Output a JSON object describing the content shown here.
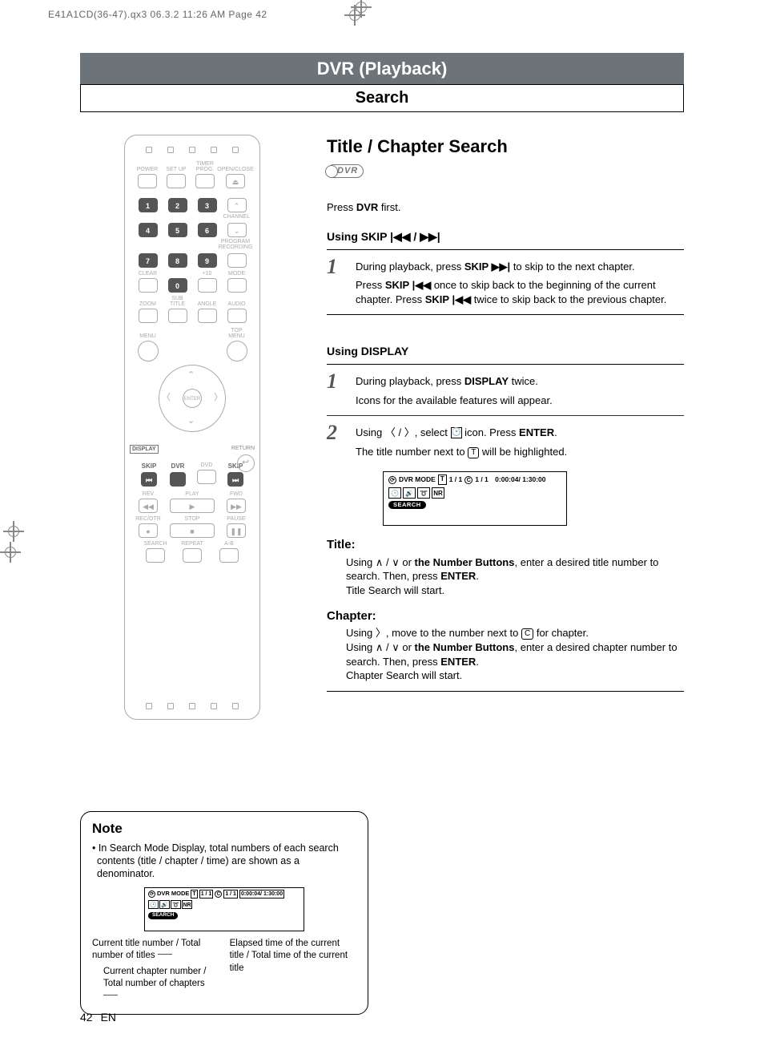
{
  "printmeta": "E41A1CD(36-47).qx3  06.3.2 11:26 AM  Page 42",
  "banner": "DVR (Playback)",
  "subbanner": "Search",
  "section_title": "Title / Chapter Search",
  "dvr_badge": "DVR",
  "intro": {
    "pre": "Press ",
    "bold": "DVR",
    "post": " first."
  },
  "using_skip_label": "Using SKIP |◀◀ / ▶▶|",
  "skip_step1": {
    "num": "1",
    "p1": {
      "pre": "During playback, press ",
      "bold": "SKIP ▶▶|",
      "post": " to skip to the next chapter."
    },
    "p2": {
      "a": "Press ",
      "b": "SKIP |◀◀",
      "c": " once to skip back to the beginning of the current chapter.  Press ",
      "d": "SKIP |◀◀",
      "e": " twice to skip back to the previous chapter."
    }
  },
  "using_display_label": "Using DISPLAY",
  "disp_step1": {
    "num": "1",
    "p1": {
      "pre": "During playback, press ",
      "bold": "DISPLAY",
      "post": " twice."
    },
    "p2": "Icons for the available features will appear."
  },
  "disp_step2": {
    "num": "2",
    "p1": {
      "a": "Using ",
      "b": "〈 / 〉",
      "c": ", select ",
      "d": " icon.  Press ",
      "e": "ENTER",
      "f": "."
    },
    "p2": {
      "a": "The title number next to ",
      "t": "T",
      "b": " will be highlighted."
    }
  },
  "osd": {
    "mode": "DVR MODE",
    "t": "T",
    "tval": "1 / 1",
    "c": "C",
    "cval": "1 / 1",
    "time": "0:00:04/ 1:30:00",
    "icons": [
      "🕑",
      "🔊",
      "➰",
      "NR"
    ],
    "search": "SEARCH"
  },
  "title_block": {
    "h": "Title:",
    "l1": {
      "a": "Using ",
      "b": "∧ / ∨",
      "c": " or ",
      "d": "the Number Buttons",
      "e": ", enter a desired title number to search.  Then, press ",
      "f": "ENTER",
      "g": "."
    },
    "l2": "Title Search will start."
  },
  "chapter_block": {
    "h": "Chapter:",
    "l1": {
      "a": "Using ",
      "b": "〉",
      "c": ", move to the number next to ",
      "d": "C",
      "e": " for chapter."
    },
    "l2": {
      "a": "Using ",
      "b": "∧ / ∨",
      "c": " or ",
      "d": "the Number Buttons",
      "e": ", enter a desired chapter number to search.  Then, press ",
      "f": "ENTER",
      "g": "."
    },
    "l3": "Chapter Search will start."
  },
  "note": {
    "h": "Note",
    "text": "• In Search Mode Display, total numbers of each search contents (title / chapter / time) are shown as a denominator.",
    "left1": "Current title number / Total number of titles",
    "left2": "Current chapter number / Total number of chapters",
    "right1": "Elapsed time of the current title / Total time of the current title"
  },
  "remote": {
    "row1": [
      "POWER",
      "SET UP",
      "TIMER PROG.",
      "OPEN/CLOSE"
    ],
    "nums": [
      "1",
      "2",
      "3",
      "4",
      "5",
      "6",
      "7",
      "8",
      "9",
      "0"
    ],
    "ch": "CHANNEL",
    "progrec": "PROGRAM RECORDING",
    "clear": "CLEAR",
    "plus10": "+10",
    "mode": "MODE",
    "row4": [
      "ZOOM",
      "SUB TITLE",
      "ANGLE",
      "AUDIO"
    ],
    "menu": "MENU",
    "topmenu": "TOP MENU",
    "enter": "ENTER",
    "display": "DISPLAY",
    "return": "RETURN",
    "skip": "SKIP",
    "dvr": "DVR",
    "dvd": "DVD",
    "rev": "REV",
    "play": "PLAY",
    "fwd": "FWD",
    "recotr": "REC/OTR",
    "stop": "STOP",
    "pause": "PAUSE",
    "search": "SEARCH",
    "repeat": "REPEAT",
    "ab": "A-B"
  },
  "page": {
    "num": "42",
    "lang": "EN"
  }
}
